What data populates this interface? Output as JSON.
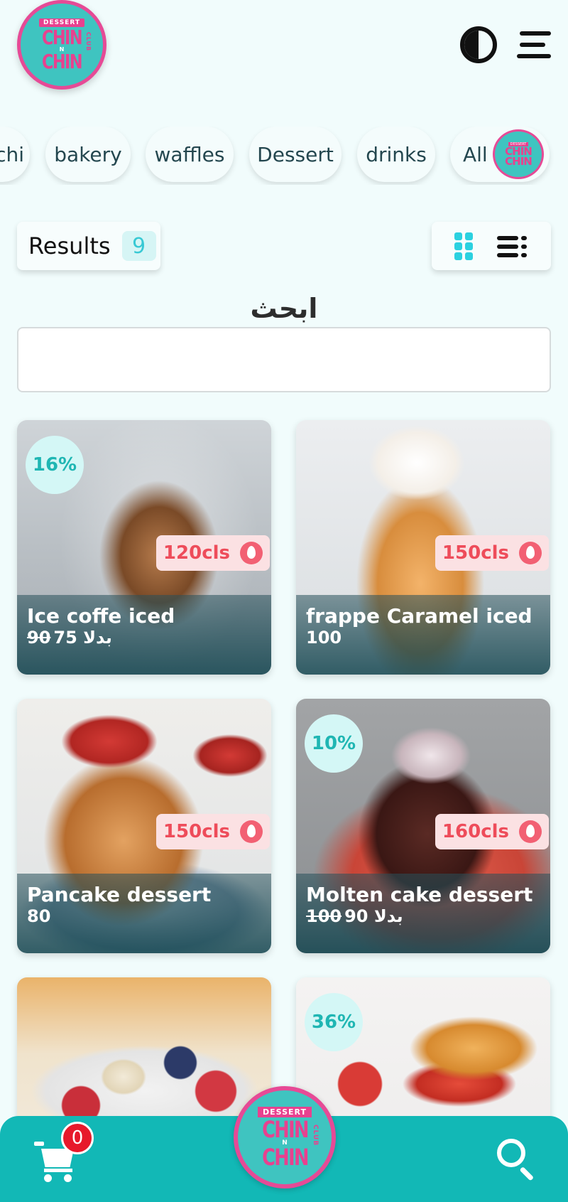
{
  "brand": {
    "tag": "DESSERT",
    "word1": "CHIN",
    "connector": "N",
    "word2": "CHIN",
    "club": "CLUB",
    "pink": "#e8418f",
    "teal": "#3fc4c0"
  },
  "header": {
    "theme_icon": "contrast-icon",
    "menu_icon": "hamburger-icon"
  },
  "categories": [
    "chi",
    "bakery",
    "waffles",
    "Dessert",
    "drinks",
    "All"
  ],
  "results": {
    "label": "Results",
    "count": "9"
  },
  "search": {
    "label": "ابحث",
    "placeholder": ""
  },
  "products": [
    {
      "name": "Ice coffe iced",
      "old_price": "90",
      "price": "75 بدلا",
      "calories": "120cls",
      "discount": "16%"
    },
    {
      "name": "frappe Caramel iced",
      "old_price": "",
      "price": "100",
      "calories": "150cls",
      "discount": ""
    },
    {
      "name": "Pancake dessert",
      "old_price": "",
      "price": "80",
      "calories": "150cls",
      "discount": ""
    },
    {
      "name": "Molten cake dessert",
      "old_price": "100",
      "price": "90 بدلا",
      "calories": "160cls",
      "discount": "10%"
    },
    {
      "name": "",
      "old_price": "",
      "price": "",
      "calories": "",
      "discount": ""
    },
    {
      "name": "",
      "old_price": "",
      "price": "",
      "calories": "",
      "discount": "36%"
    }
  ],
  "bottom_bar": {
    "cart_count": "0",
    "cart_icon": "cart-icon",
    "search_icon": "search-icon",
    "color": "#12b8b6"
  }
}
